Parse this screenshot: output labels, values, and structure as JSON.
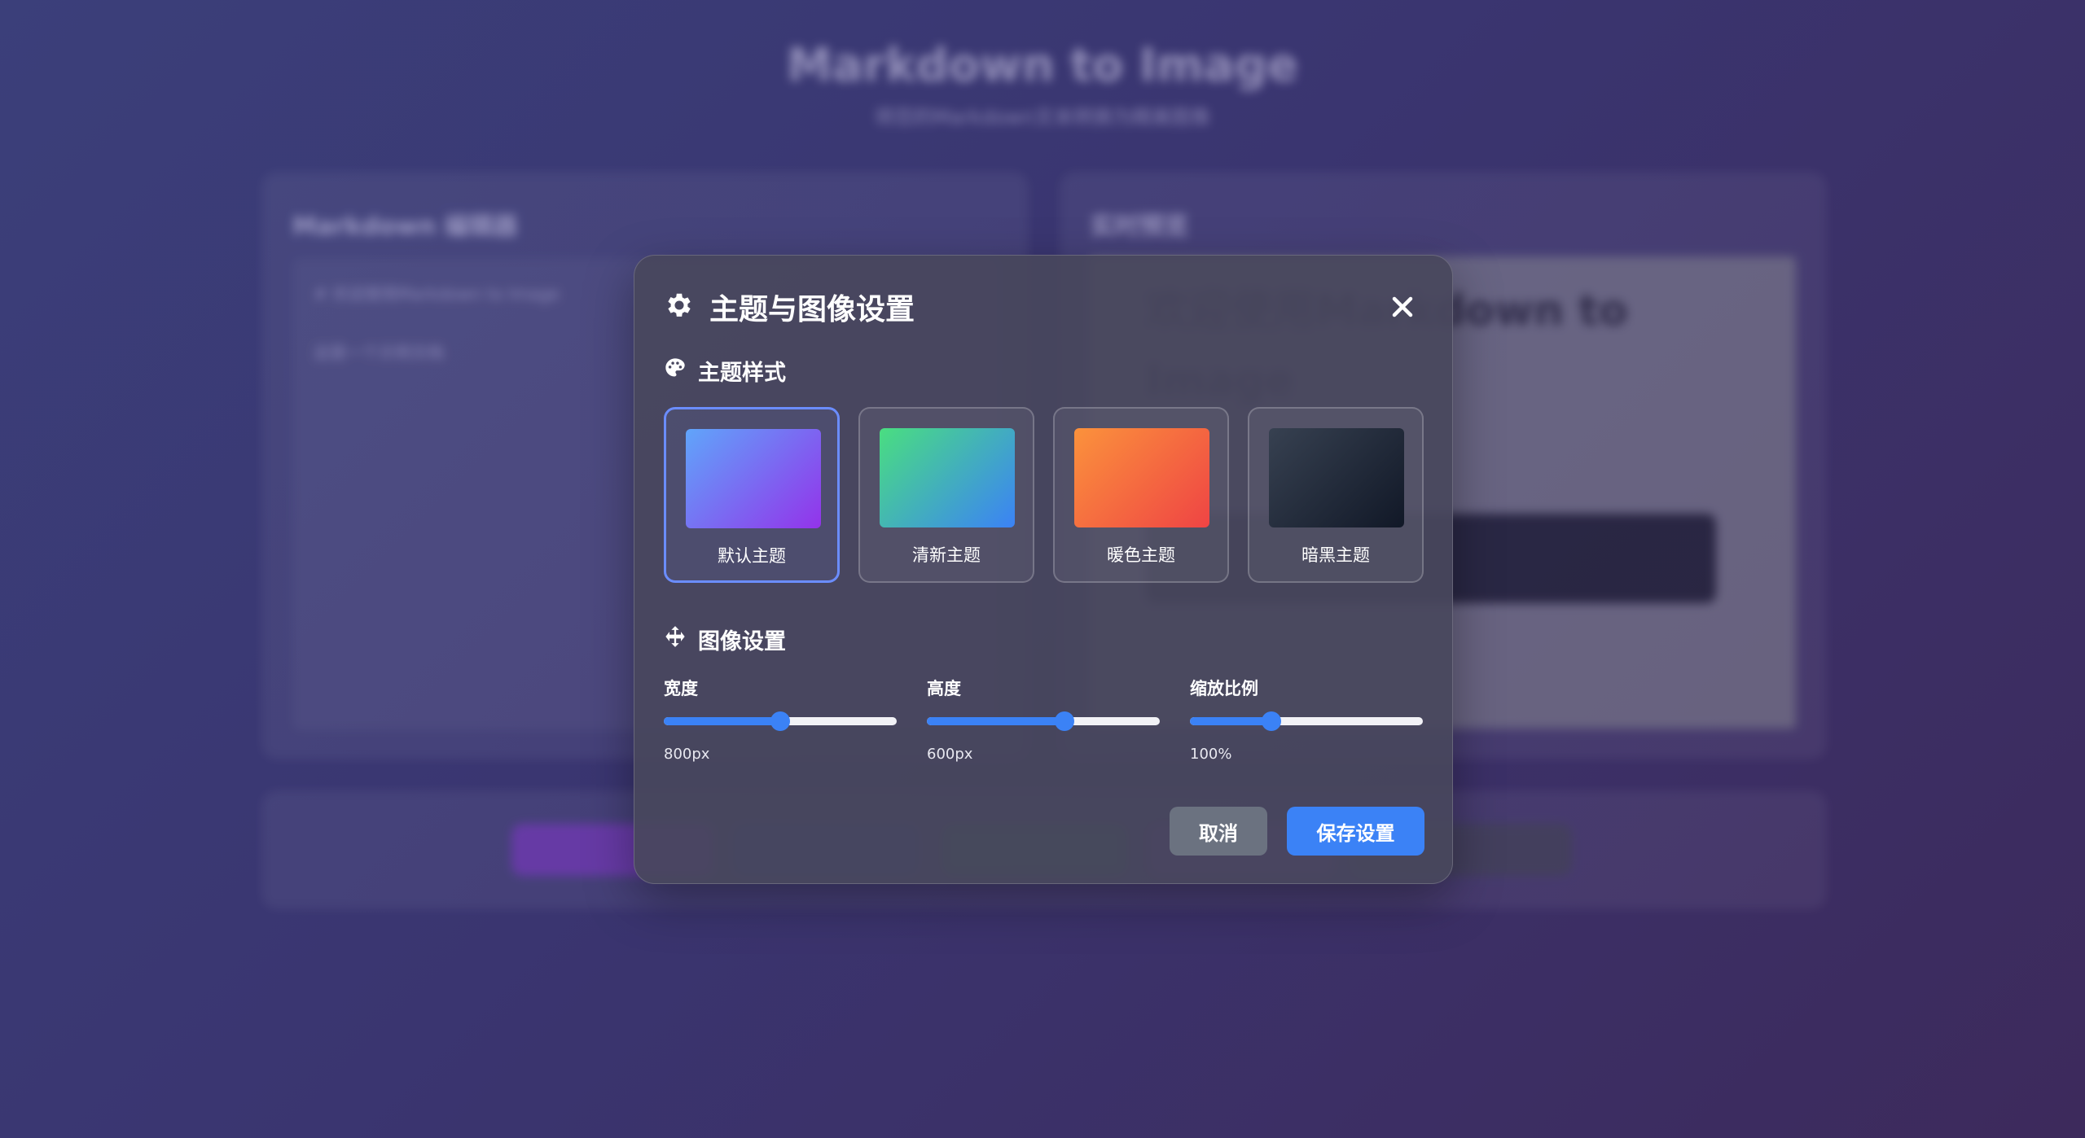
{
  "background": {
    "app_title": "Markdown to Image",
    "app_subtitle": "将您的Markdown文本转换为精美图像",
    "editor_title": "Markdown 编辑器",
    "editor_text": "# 欢迎使用Markdown to Image\n\n这是一个示例文档",
    "preview_title": "实时预览",
    "preview_heading": "欢迎使用Markdown to Image"
  },
  "modal": {
    "title": "主题与图像设置",
    "theme_section_title": "主题样式",
    "image_section_title": "图像设置",
    "themes": [
      {
        "label": "默认主题",
        "selected": true,
        "colors": [
          "#60a5fa",
          "#9333ea"
        ]
      },
      {
        "label": "清新主题",
        "selected": false,
        "colors": [
          "#4ade80",
          "#3b82f6"
        ]
      },
      {
        "label": "暖色主题",
        "selected": false,
        "colors": [
          "#fb923c",
          "#ef4444"
        ]
      },
      {
        "label": "暗黑主题",
        "selected": false,
        "colors": [
          "#374151",
          "#111827"
        ]
      }
    ],
    "sliders": [
      {
        "label": "宽度",
        "value_text": "800px",
        "fraction": 0.5
      },
      {
        "label": "高度",
        "value_text": "600px",
        "fraction": 0.59
      },
      {
        "label": "缩放比例",
        "value_text": "100%",
        "fraction": 0.35
      }
    ],
    "cancel_label": "取消",
    "save_label": "保存设置"
  },
  "colors": {
    "accent": "#3b82f6",
    "selected_border": "#6b8dff",
    "cancel": "#6b7280"
  }
}
